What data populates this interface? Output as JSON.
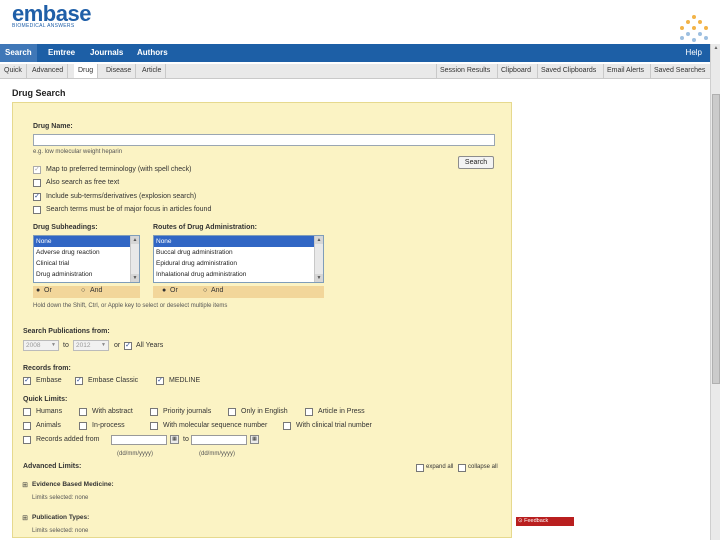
{
  "brand": {
    "name": "embase",
    "tagline": "BIOMEDICAL ANSWERS"
  },
  "nav_primary": {
    "items": [
      "Search",
      "Emtree",
      "Journals",
      "Authors"
    ],
    "help": "Help"
  },
  "nav_secondary": {
    "left": [
      "Quick",
      "Advanced",
      "Drug",
      "Disease",
      "Article"
    ],
    "right": [
      "Session Results",
      "Clipboard",
      "Saved Clipboards",
      "Email Alerts",
      "Saved Searches"
    ]
  },
  "page_title": "Drug Search",
  "drug_search": {
    "drug_name_label": "Drug Name:",
    "drug_name_value": "",
    "drug_name_example": "e.g. low molecular weight heparin",
    "search_button": "Search",
    "options": [
      {
        "label": "Map to preferred terminology (with spell check)",
        "checked": true,
        "disabled": true
      },
      {
        "label": "Also search as free text",
        "checked": false,
        "disabled": false
      },
      {
        "label": "Include sub-terms/derivatives (explosion search)",
        "checked": true,
        "disabled": false
      },
      {
        "label": "Search terms must be of major focus in articles found",
        "checked": false,
        "disabled": false
      }
    ]
  },
  "drug_subheadings": {
    "label": "Drug Subheadings:",
    "items": [
      "None",
      "Adverse drug reaction",
      "Clinical trial",
      "Drug administration"
    ],
    "selected": "None",
    "or_label": "Or",
    "and_label": "And"
  },
  "routes": {
    "label": "Routes of Drug Administration:",
    "items": [
      "None",
      "Buccal drug administration",
      "Epidural drug administration",
      "Inhalational drug administration"
    ],
    "selected": "None",
    "or_label": "Or",
    "and_label": "And"
  },
  "multi_select_hint": "Hold down the Shift, Ctrl, or Apple key to select or deselect multiple items",
  "publication_years": {
    "label": "Search Publications from:",
    "from": "2008",
    "to_label": "to",
    "to": "2012",
    "or_label": "or",
    "all_years_label": "All Years",
    "all_years_checked": true
  },
  "records_from": {
    "label": "Records from:",
    "items": [
      {
        "label": "Embase",
        "checked": true
      },
      {
        "label": "Embase Classic",
        "checked": true
      },
      {
        "label": "MEDLINE",
        "checked": true
      }
    ]
  },
  "quick_limits": {
    "label": "Quick Limits:",
    "row1": [
      "Humans",
      "With abstract",
      "Priority journals",
      "Only in English",
      "Article in Press"
    ],
    "row2": [
      "Animals",
      "In-process",
      "With molecular sequence number",
      "With clinical trial number"
    ],
    "records_added_label": "Records added from",
    "to_label": "to",
    "date_format_from": "(dd/mm/yyyy)",
    "date_format_to": "(dd/mm/yyyy)"
  },
  "advanced_limits": {
    "label": "Advanced Limits:",
    "expand_all": "expand all",
    "collapse_all": "collapse all",
    "sections": [
      {
        "title": "Evidence Based Medicine:",
        "summary": "Limits selected: none"
      },
      {
        "title": "Publication Types:",
        "summary": "Limits selected: none"
      }
    ]
  },
  "feedback": {
    "label": "Feedback"
  },
  "colors": {
    "nav_blue": "#1d5fa6",
    "panel_yellow": "#fbf3c4",
    "selection_blue": "#3166c4",
    "feedback_red": "#b91f1f"
  },
  "icons": [
    "checkbox-icon",
    "calendar-icon",
    "expand-icon",
    "scroll-arrow-icon",
    "feedback-icon"
  ]
}
